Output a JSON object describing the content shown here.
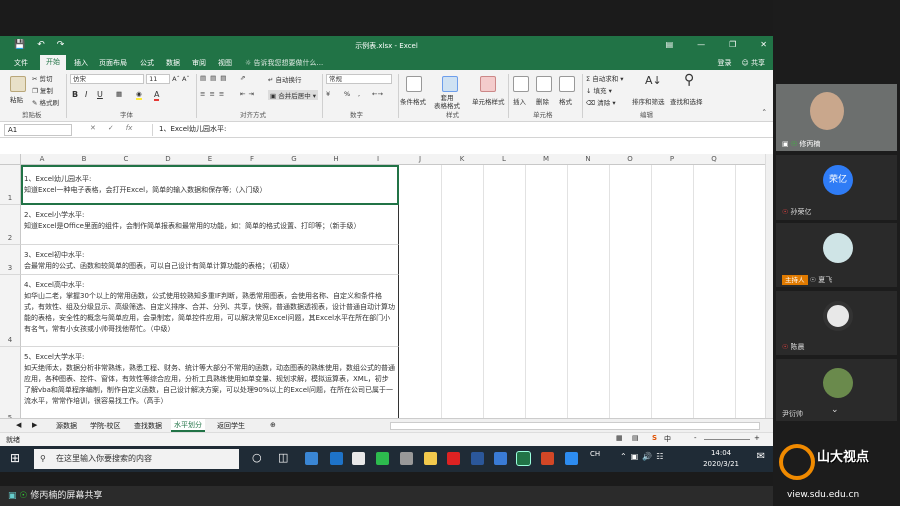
{
  "window": {
    "title": "示例表.xlsx - Excel",
    "login": "登录",
    "share": "共享"
  },
  "tabs": [
    "文件",
    "开始",
    "插入",
    "页面布局",
    "公式",
    "数据",
    "审阅",
    "视图"
  ],
  "tell_me": "告诉我您想要做什么...",
  "ribbon": {
    "paste": "粘贴",
    "cut": "剪切",
    "copy": "复制",
    "format_painter": "格式刷",
    "clipboard": "剪贴板",
    "font_name": "仿宋",
    "font_size": "11",
    "bold": "B",
    "italic": "I",
    "underline": "U",
    "font_group": "字体",
    "wrap": "自动换行",
    "merge": "合并后居中",
    "align_group": "对齐方式",
    "number_format": "常规",
    "percent": "%",
    "comma": ",",
    "number_group": "数字",
    "cond_format": "条件格式",
    "table_format": "套用\n表格格式",
    "cell_style": "单元格样式",
    "style_group": "样式",
    "insert": "插入",
    "delete": "删除",
    "format": "格式",
    "cells_group": "单元格",
    "autosum": "自动求和",
    "fill": "填充",
    "clear": "清除",
    "sort_filter": "排序和筛选",
    "find_select": "查找和选择",
    "edit_group": "编辑"
  },
  "formula": {
    "namebox": "A1",
    "fx": "fx",
    "content": "1、Excel幼儿园水平:"
  },
  "columns": [
    "A",
    "B",
    "C",
    "D",
    "E",
    "F",
    "G",
    "H",
    "I",
    "J",
    "K",
    "L",
    "M",
    "N",
    "O",
    "P",
    "Q"
  ],
  "rows": [
    {
      "num": "1",
      "text": "1、Excel幼儿园水平:\n知道Excel一种电子表格，会打开Excel，简单的输入数据和保存等;（入门级）"
    },
    {
      "num": "2",
      "text": "2、Excel小学水平:\n知道Excel是Office里面的组件，会制作简单报表和最常用的功能，如：简单的格式设置、打印等；（新手级）"
    },
    {
      "num": "3",
      "text": "3、Excel初中水平:\n会最常用的公式、函数和较简单的图表，可以自己设计有简单计算功能的表格；（初级）"
    },
    {
      "num": "4",
      "text": "4、Excel高中水平:\n如华山二老，掌握30个以上的常用函数，公式使用较熟知多重IF判断，熟悉常用图表，会使用名称、自定义和条件格式，有效性、组及分级显示、高级筛选、自定义排序、合并、分列、共享，快照，普通数据透视表，设计普通自动计算功能的表格，安全性的概念与简单应用，会录制宏，简单控件应用，可以解决常见Excel问题，其Excel水平在所在部门小有名气，常有小女孩或小帅哥找他帮忙。（中级）"
    },
    {
      "num": "5",
      "text": "5、Excel大学水平:\n如天绝师太，数据分析非常熟练，熟悉工程、财务、统计等大部分不常用的函数，动态图表的熟练使用，数组公式的普通应用，各种图表、控件、窗体，有效性等综合应用，分析工具熟练使用如单变量、规划求解，模拟运算表，XML，初步了解vba和简单程序编制，制作自定义函数，自己设计解决方案，可以处理90%以上的Excel问题，在所在公司已属于一流水平，常常作培训，很容易找工作。（高手）"
    }
  ],
  "sheets": [
    "源数据",
    "学院-校区",
    "查找数据",
    "水平划分",
    "返回学生"
  ],
  "active_sheet": "水平划分",
  "status": {
    "ready": "就绪",
    "zoom_minus": "-",
    "zoom_plus": "+"
  },
  "taskbar": {
    "search_placeholder": "在这里输入你要搜索的内容",
    "time": "14:04",
    "date": "2020/3/21",
    "ime": "中",
    "lang": "CH"
  },
  "share_bar": "修丙楠的屏幕共享",
  "participants": [
    {
      "name": "修丙楠"
    },
    {
      "name": "孙荣亿",
      "avatar_text": "荣亿"
    },
    {
      "name": "夏飞",
      "host": "主持人"
    },
    {
      "name": "陈晨"
    },
    {
      "name": "尹衍帅"
    }
  ],
  "logo": {
    "brand": "山大视点",
    "url": "view.sdu.edu.cn"
  },
  "colors": {
    "excel_green": "#217346",
    "host_orange": "#e07a00",
    "avatar_blue": "#2f7cf6",
    "logo_orange": "#f08a00"
  }
}
